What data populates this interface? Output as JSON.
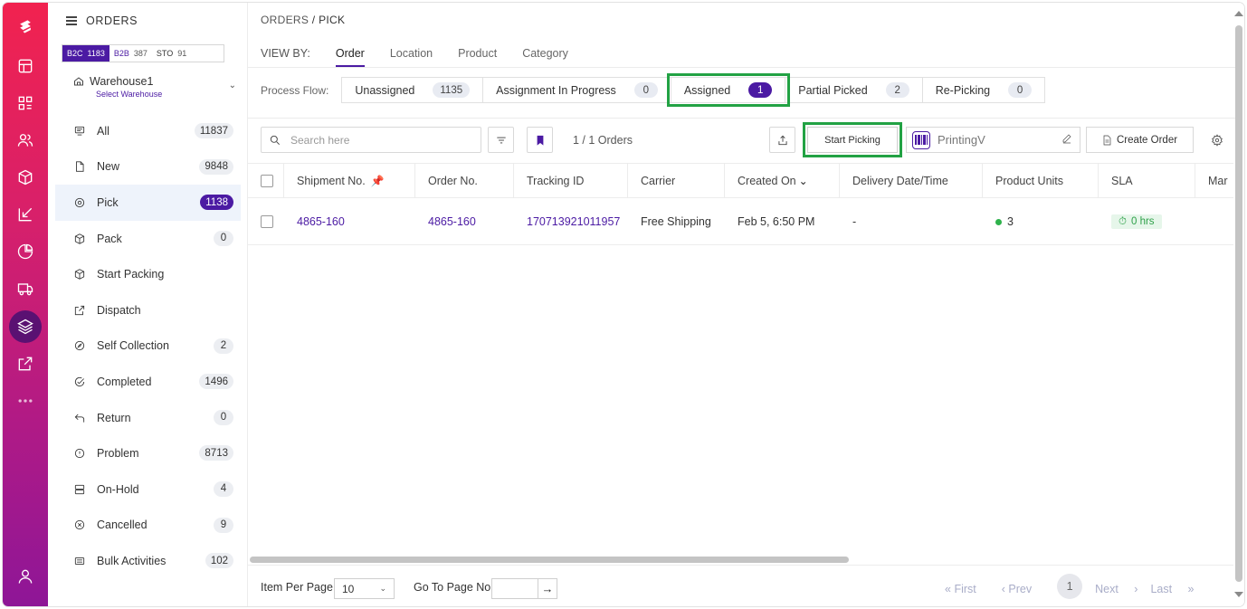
{
  "sidebar": {
    "title": "ORDERS",
    "channels": [
      {
        "label": "B2C",
        "count": "1183",
        "active": true
      },
      {
        "label": "B2B",
        "count": "387",
        "active": false
      },
      {
        "label": "STO",
        "count": "91",
        "active": false
      }
    ],
    "warehouse": {
      "name": "Warehouse1",
      "sub": "Select Warehouse"
    },
    "items": [
      {
        "label": "All",
        "badge": "11837",
        "icon": "list-icon"
      },
      {
        "label": "New",
        "badge": "9848",
        "icon": "file-icon"
      },
      {
        "label": "Pick",
        "badge": "1138",
        "icon": "target-icon",
        "active": true
      },
      {
        "label": "Pack",
        "badge": "0",
        "icon": "box-icon"
      },
      {
        "label": "Start Packing",
        "badge": "",
        "icon": "box-icon"
      },
      {
        "label": "Dispatch",
        "badge": "",
        "icon": "external-link-icon"
      },
      {
        "label": "Self Collection",
        "badge": "2",
        "icon": "compass-icon"
      },
      {
        "label": "Completed",
        "badge": "1496",
        "icon": "check-circle-icon"
      },
      {
        "label": "Return",
        "badge": "0",
        "icon": "return-arrow-icon"
      },
      {
        "label": "Problem",
        "badge": "8713",
        "icon": "alert-circle-icon"
      },
      {
        "label": "On-Hold",
        "badge": "4",
        "icon": "server-icon"
      },
      {
        "label": "Cancelled",
        "badge": "9",
        "icon": "x-circle-icon"
      },
      {
        "label": "Bulk Activities",
        "badge": "102",
        "icon": "stack-icon"
      }
    ]
  },
  "breadcrumb": {
    "parent": "ORDERS",
    "sep": "/",
    "current": "PICK"
  },
  "viewby": {
    "label": "VIEW BY:",
    "tabs": [
      "Order",
      "Location",
      "Product",
      "Category"
    ],
    "active": "Order"
  },
  "process_flow": {
    "label": "Process Flow:",
    "steps": [
      {
        "label": "Unassigned",
        "count": "1135"
      },
      {
        "label": "Assignment In Progress",
        "count": "0"
      },
      {
        "label": "Assigned",
        "count": "1",
        "active": true
      },
      {
        "label": "Partial Picked",
        "count": "2"
      },
      {
        "label": "Re-Picking",
        "count": "0"
      }
    ]
  },
  "toolbar": {
    "search_placeholder": "Search here",
    "order_count": "1 / 1 Orders",
    "start_picking": "Start Picking",
    "printer": "PrintingV",
    "create_order": "Create Order"
  },
  "table": {
    "columns": [
      "Shipment No.",
      "Order No.",
      "Tracking ID",
      "Carrier",
      "Created On",
      "Delivery Date/Time",
      "Product Units",
      "SLA",
      "Mar"
    ],
    "rows": [
      {
        "shipment": "4865-160",
        "order": "4865-160",
        "tracking": "170713921011957",
        "carrier": "Free Shipping",
        "created": "Feb 5, 6:50 PM",
        "delivery": "-",
        "units": "3",
        "sla": "0 hrs"
      }
    ]
  },
  "footer": {
    "items_per_page_label": "Item Per Page",
    "items_per_page": "10",
    "goto_label": "Go To Page No.",
    "goto_btn": "→",
    "first": "First",
    "prev": "Prev",
    "page": "1",
    "next": "Next",
    "last": "Last"
  },
  "colors": {
    "accent": "#4b1aa3",
    "highlight": "#22a244",
    "rail_top": "#f1224f",
    "rail_bottom": "#8e1697"
  }
}
